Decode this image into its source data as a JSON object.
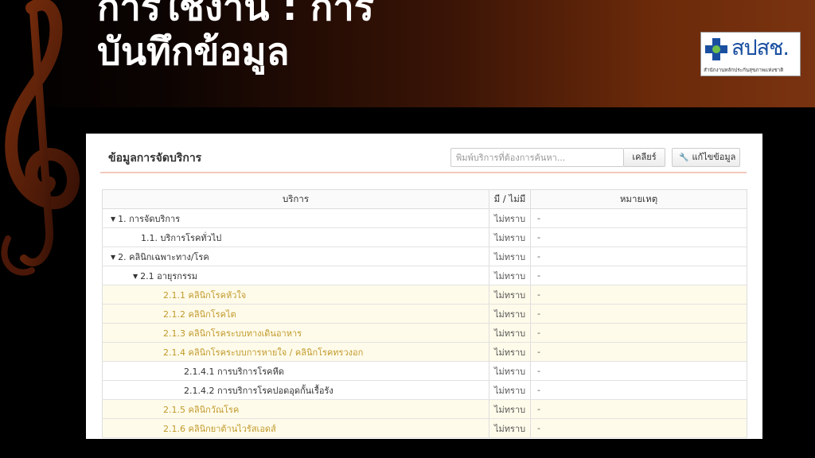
{
  "slide": {
    "title_line1": "การใช้งาน : การ",
    "title_line2": "บันทึกข้อมูล"
  },
  "logo": {
    "brand": "สปสช.",
    "subtitle": "สำนักงานหลักประกันสุขภาพแห่งชาติ"
  },
  "panel": {
    "title": "ข้อมูลการจัดบริการ",
    "search_placeholder": "พิมพ์บริการที่ต้องการค้นหา...",
    "clear_label": "เคลียร์",
    "edit_label": "แก้ไขข้อมูล"
  },
  "table": {
    "headers": [
      "บริการ",
      "มี / ไม่มี",
      "หมายเหตุ"
    ],
    "rows": [
      {
        "label": "1. การจัดบริการ",
        "status": "ไม่ทราบ",
        "note": "-"
      },
      {
        "label": "1.1. บริการโรคทั่วไป",
        "status": "ไม่ทราบ",
        "note": "-"
      },
      {
        "label": "2. คลินิกเฉพาะทาง/โรค",
        "status": "ไม่ทราบ",
        "note": "-"
      },
      {
        "label": "2.1 อายุรกรรม",
        "status": "ไม่ทราบ",
        "note": "-"
      },
      {
        "label": "2.1.1 คลินิกโรคหัวใจ",
        "status": "ไม่ทราบ",
        "note": "-"
      },
      {
        "label": "2.1.2 คลินิกโรคไต",
        "status": "ไม่ทราบ",
        "note": "-"
      },
      {
        "label": "2.1.3 คลินิกโรคระบบทางเดินอาหาร",
        "status": "ไม่ทราบ",
        "note": "-"
      },
      {
        "label": "2.1.4 คลินิกโรคระบบการหายใจ / คลินิกโรคทรวงอก",
        "status": "ไม่ทราบ",
        "note": "-"
      },
      {
        "label": "2.1.4.1 การบริการโรคหืด",
        "status": "ไม่ทราบ",
        "note": "-"
      },
      {
        "label": "2.1.4.2 การบริการโรคปอดอุดกั้นเรื้อรัง",
        "status": "ไม่ทราบ",
        "note": "-"
      },
      {
        "label": "2.1.5 คลินิกวัณโรค",
        "status": "ไม่ทราบ",
        "note": "-"
      },
      {
        "label": "2.1.6 คลินิกยาต้านไวรัสเอดส์",
        "status": "ไม่ทราบ",
        "note": "-"
      }
    ]
  },
  "colors": {
    "highlight_text": "#c09a2c",
    "highlight_bg": "#fffbea",
    "header_underline": "#f3c7bd",
    "brand_blue": "#1a4fa0"
  }
}
